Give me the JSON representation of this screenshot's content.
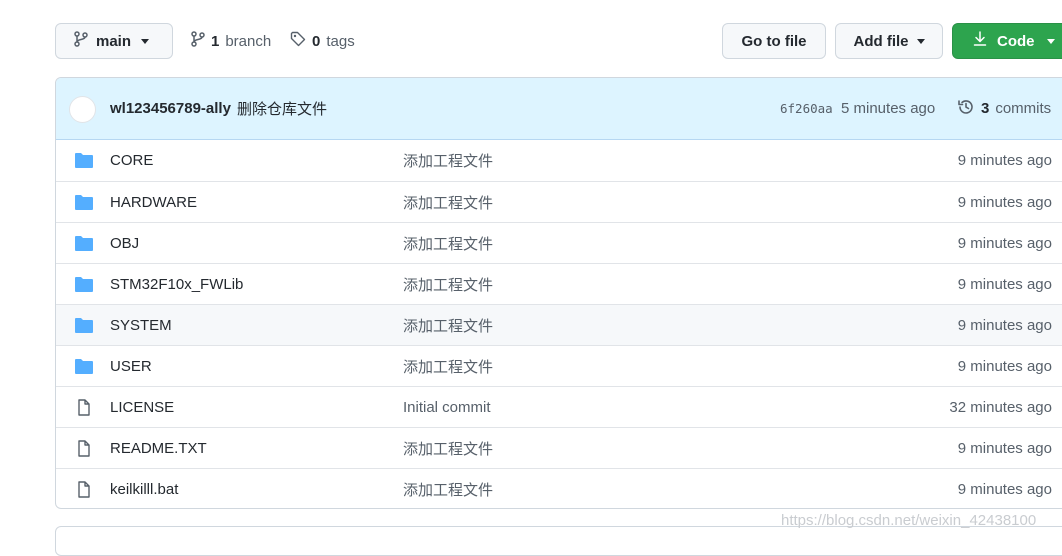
{
  "toolbar": {
    "branch_button_label": "main",
    "branches_count": "1",
    "branches_label": "branch",
    "tags_count": "0",
    "tags_label": "tags",
    "goto_file_label": "Go to file",
    "add_file_label": "Add file",
    "code_label": "Code"
  },
  "commit": {
    "author": "wl123456789-ally",
    "message": "删除仓库文件",
    "sha": "6f260aa",
    "time": "5 minutes ago",
    "commits_count": "3",
    "commits_label": "commits"
  },
  "files": [
    {
      "type": "dir",
      "name": "CORE",
      "message": "添加工程文件",
      "age": "9 minutes ago"
    },
    {
      "type": "dir",
      "name": "HARDWARE",
      "message": "添加工程文件",
      "age": "9 minutes ago"
    },
    {
      "type": "dir",
      "name": "OBJ",
      "message": "添加工程文件",
      "age": "9 minutes ago"
    },
    {
      "type": "dir",
      "name": "STM32F10x_FWLib",
      "message": "添加工程文件",
      "age": "9 minutes ago"
    },
    {
      "type": "dir",
      "name": "SYSTEM",
      "message": "添加工程文件",
      "age": "9 minutes ago"
    },
    {
      "type": "dir",
      "name": "USER",
      "message": "添加工程文件",
      "age": "9 minutes ago"
    },
    {
      "type": "file",
      "name": "LICENSE",
      "message": "Initial commit",
      "age": "32 minutes ago"
    },
    {
      "type": "file",
      "name": "README.TXT",
      "message": "添加工程文件",
      "age": "9 minutes ago"
    },
    {
      "type": "file",
      "name": "keilkilll.bat",
      "message": "添加工程文件",
      "age": "9 minutes ago"
    }
  ],
  "watermark": "https://blog.csdn.net/weixin_42438100",
  "colors": {
    "folder": "#54aeff",
    "file": "#57606a",
    "code_button": "#2da44e",
    "commit_bar": "#ddf4ff"
  }
}
